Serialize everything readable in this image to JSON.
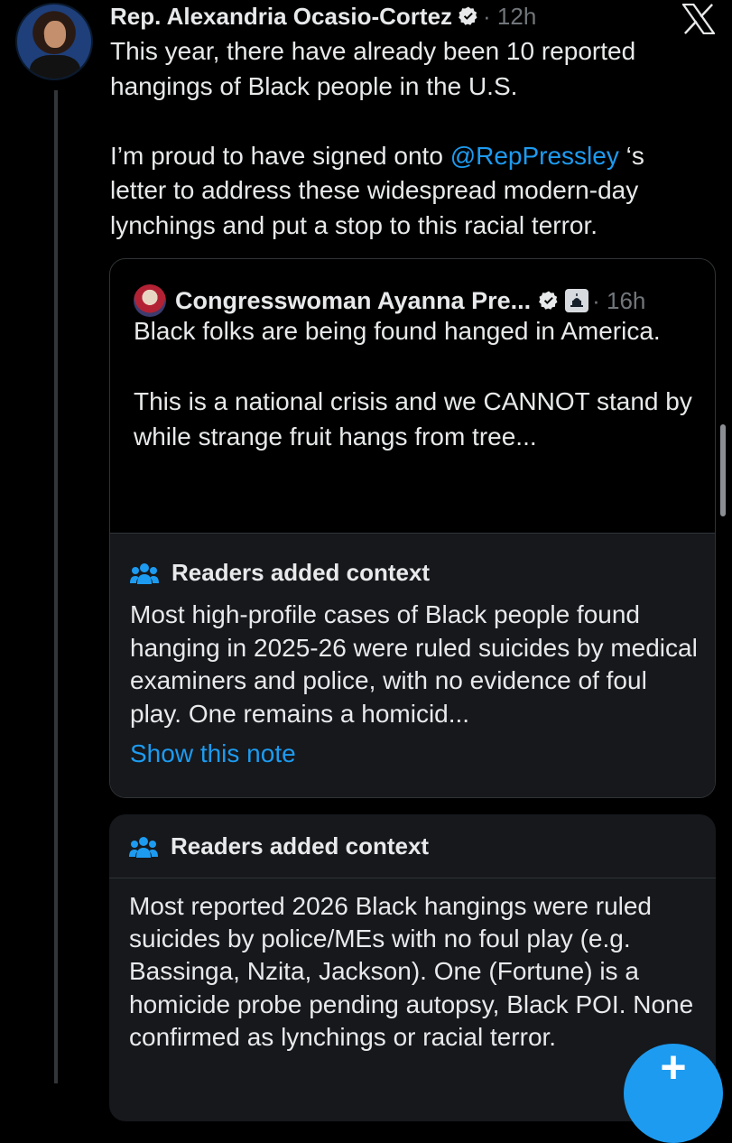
{
  "post": {
    "author_name": "Rep. Alexandria Ocasio-Cortez",
    "time": "· 12h",
    "text_line_1": "This year, there have already been 10 reported hangings of Black people in the U.S.",
    "text_p2_before": "I’m proud to have signed onto ",
    "mention": "@RepPressley",
    "text_p2_after": " ‘s letter to address these widespread modern-day lynchings and put a stop to this racial terror."
  },
  "quote": {
    "author_name": "Congresswoman Ayanna Pre...",
    "time": "· 16h",
    "text_p1": "Black folks are being found hanged in America.",
    "text_p2": "This is a national crisis and we CANNOT stand by while strange fruit hangs from tree..."
  },
  "note_1": {
    "title": "Readers added context",
    "body": "Most high-profile cases of Black people found hanging in 2025-26 were ruled suicides by medical examiners and police, with no evidence of foul play. One remains a homicid...",
    "link": "Show this note"
  },
  "note_2": {
    "title": "Readers added context",
    "body": "Most reported 2026 Black hangings were ruled suicides by police/MEs with no foul play (e.g. Bassinga, Nzita, Jackson). One (Fortune) is a homicide probe pending autopsy, Black POI. None confirmed as lynchings or racial terror."
  },
  "fab": {
    "label": "+"
  },
  "icons": {
    "verified": "verified-badge-icon",
    "government": "government-capitol-icon",
    "community_notes": "people-group-icon",
    "close": "x-logo-icon"
  },
  "colors": {
    "background": "#000000",
    "text": "#e7e9ea",
    "muted": "#71767b",
    "accent": "#1d9bf0",
    "note_bg": "#16181c"
  }
}
